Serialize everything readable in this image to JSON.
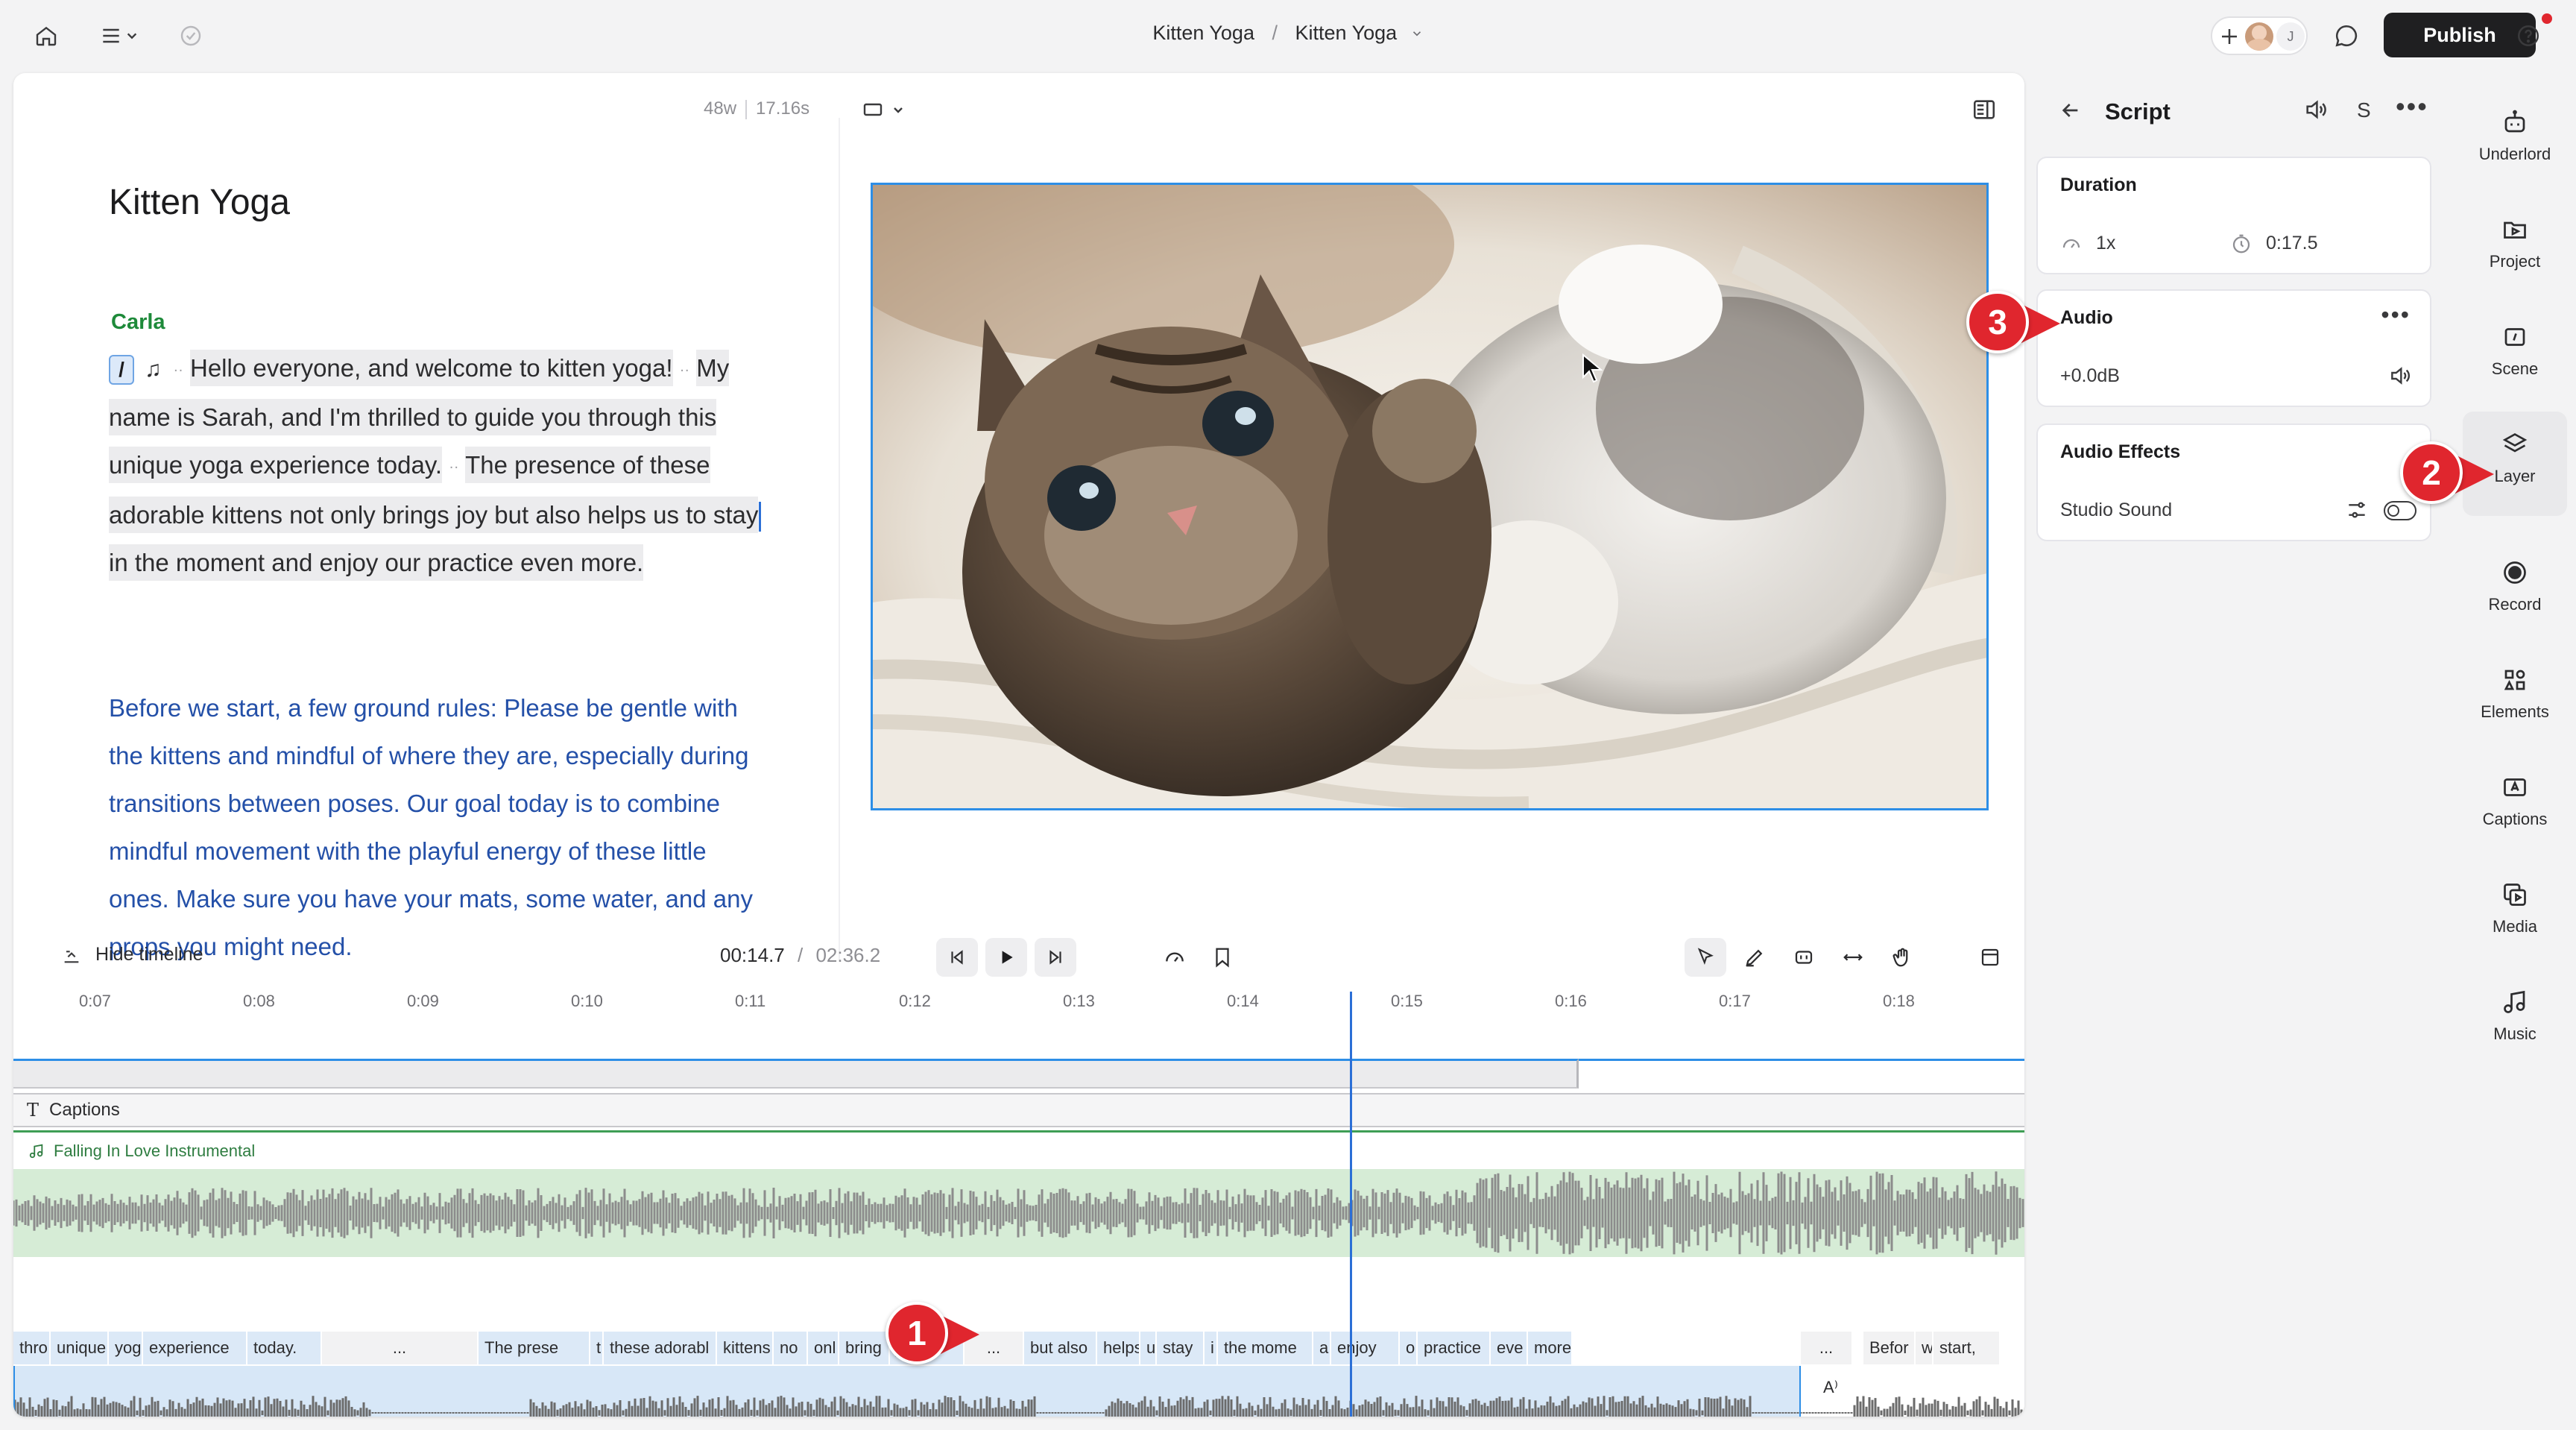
{
  "breadcrumb": {
    "project": "Kitten Yoga",
    "separator": "/",
    "composition": "Kitten Yoga"
  },
  "topbar": {
    "publish_label": "Publish",
    "avatar_initial": "J"
  },
  "script": {
    "word_count": "48w",
    "duration": "17.16s",
    "title": "Kitten Yoga",
    "speaker": "Carla",
    "slash_chip": "/",
    "note_glyph": "♫",
    "para1_part1": "Hello everyone, and welcome to kitten yoga!",
    "para1_part2": "My name is Sarah, and I'm thrilled to guide you through this unique yoga experience today.",
    "para1_part3": "The presence of these adorable kittens not only brings joy but also helps us to stay",
    "para1_part4": "in the moment and enjoy our practice even more.",
    "para2": "Before we start, a few ground rules: Please be gentle with the kittens and mindful of where they are, especially during transitions between poses. Our goal today is to combine mindful movement with the playful energy of these little ones. Make sure you have your mats, some water, and any props you might need."
  },
  "timeline": {
    "hide_label": "Hide timeline",
    "current_time": "00:14.7",
    "time_separator": "/",
    "total_time": "02:36.2",
    "ruler_ticks": [
      "0:07",
      "0:08",
      "0:09",
      "0:10",
      "0:11",
      "0:12",
      "0:13",
      "0:14",
      "0:15",
      "0:16",
      "0:17",
      "0:18"
    ],
    "captions_label": "Captions",
    "music_label": "Falling In Love Instrumental",
    "words": [
      "thro",
      "unique",
      "yoga",
      "experience",
      "today.",
      "...",
      "The prese",
      "t",
      "these adorabl",
      "kittens",
      "no",
      "onl",
      "bring",
      "joy",
      "...",
      "but also",
      "helps",
      "u",
      "stay",
      "i",
      "the mome",
      "a",
      "enjoy",
      "o",
      "practice",
      "eve",
      "more.",
      "...",
      "Befor",
      "w",
      "start,"
    ],
    "voice_marker": "A⁾"
  },
  "panel": {
    "title": "Script",
    "header_letter": "S",
    "duration_title": "Duration",
    "speed": "1x",
    "duration_value": "0:17.5",
    "audio_title": "Audio",
    "audio_gain": "+0.0dB",
    "effects_title": "Audio Effects",
    "studio_sound": "Studio Sound"
  },
  "rail": {
    "items": [
      "Underlord",
      "Project",
      "Scene",
      "Layer",
      "Record",
      "Elements",
      "Captions",
      "Media",
      "Music"
    ]
  },
  "badges": [
    "1",
    "2",
    "3"
  ],
  "colors": {
    "accent": "#2d8ee6",
    "publish": "#1f1f21",
    "speaker": "#1e8a3a",
    "para2": "#2450a8",
    "badge": "#e0262e",
    "music": "#3f9e55"
  }
}
